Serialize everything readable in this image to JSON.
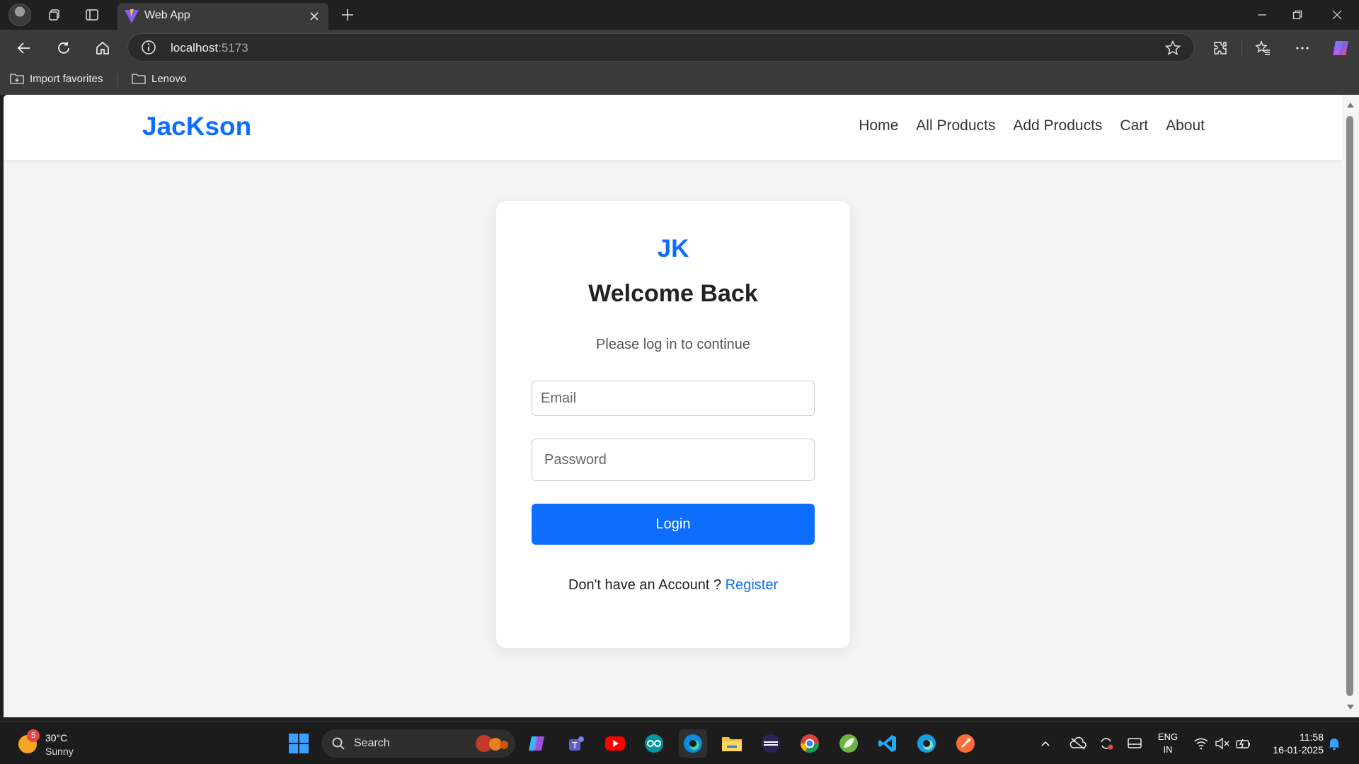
{
  "browser": {
    "tab_title": "Web App",
    "url_host": "localhost",
    "url_port": ":5173",
    "favorites": [
      "Import favorites",
      "Lenovo"
    ]
  },
  "site": {
    "brand": "JacKson",
    "nav": [
      "Home",
      "All Products",
      "Add Products",
      "Cart",
      "About"
    ]
  },
  "login": {
    "logo": "JK",
    "title": "Welcome Back",
    "subtitle": "Please log in to continue",
    "email_placeholder": "Email",
    "password_placeholder": "Password",
    "login_label": "Login",
    "register_prompt": "Don't have an Account ?",
    "register_link": "Register"
  },
  "taskbar": {
    "weather_badge": "5",
    "weather_temp": "30°C",
    "weather_cond": "Sunny",
    "search_label": "Search",
    "lang_top": "ENG",
    "lang_bottom": "IN",
    "time": "11:58",
    "date": "16-01-2025"
  },
  "colors": {
    "accent": "#0d6efd",
    "page_bg": "#f4f4f4"
  }
}
